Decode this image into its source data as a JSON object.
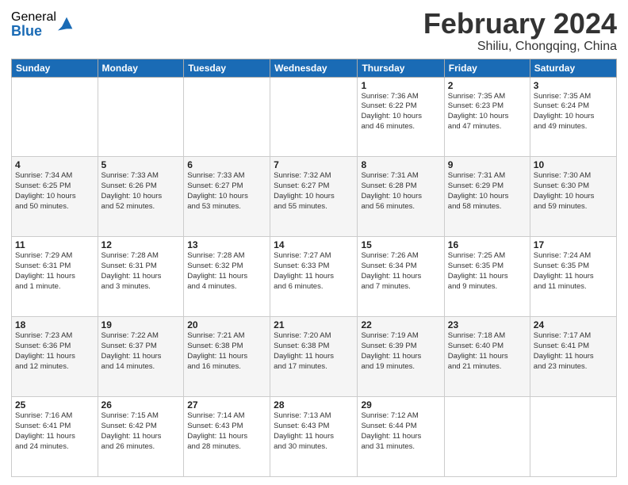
{
  "header": {
    "logo_general": "General",
    "logo_blue": "Blue",
    "month_title": "February 2024",
    "location": "Shiliu, Chongqing, China"
  },
  "days_of_week": [
    "Sunday",
    "Monday",
    "Tuesday",
    "Wednesday",
    "Thursday",
    "Friday",
    "Saturday"
  ],
  "weeks": [
    [
      {
        "day": "",
        "info": ""
      },
      {
        "day": "",
        "info": ""
      },
      {
        "day": "",
        "info": ""
      },
      {
        "day": "",
        "info": ""
      },
      {
        "day": "1",
        "info": "Sunrise: 7:36 AM\nSunset: 6:22 PM\nDaylight: 10 hours\nand 46 minutes."
      },
      {
        "day": "2",
        "info": "Sunrise: 7:35 AM\nSunset: 6:23 PM\nDaylight: 10 hours\nand 47 minutes."
      },
      {
        "day": "3",
        "info": "Sunrise: 7:35 AM\nSunset: 6:24 PM\nDaylight: 10 hours\nand 49 minutes."
      }
    ],
    [
      {
        "day": "4",
        "info": "Sunrise: 7:34 AM\nSunset: 6:25 PM\nDaylight: 10 hours\nand 50 minutes."
      },
      {
        "day": "5",
        "info": "Sunrise: 7:33 AM\nSunset: 6:26 PM\nDaylight: 10 hours\nand 52 minutes."
      },
      {
        "day": "6",
        "info": "Sunrise: 7:33 AM\nSunset: 6:27 PM\nDaylight: 10 hours\nand 53 minutes."
      },
      {
        "day": "7",
        "info": "Sunrise: 7:32 AM\nSunset: 6:27 PM\nDaylight: 10 hours\nand 55 minutes."
      },
      {
        "day": "8",
        "info": "Sunrise: 7:31 AM\nSunset: 6:28 PM\nDaylight: 10 hours\nand 56 minutes."
      },
      {
        "day": "9",
        "info": "Sunrise: 7:31 AM\nSunset: 6:29 PM\nDaylight: 10 hours\nand 58 minutes."
      },
      {
        "day": "10",
        "info": "Sunrise: 7:30 AM\nSunset: 6:30 PM\nDaylight: 10 hours\nand 59 minutes."
      }
    ],
    [
      {
        "day": "11",
        "info": "Sunrise: 7:29 AM\nSunset: 6:31 PM\nDaylight: 11 hours\nand 1 minute."
      },
      {
        "day": "12",
        "info": "Sunrise: 7:28 AM\nSunset: 6:31 PM\nDaylight: 11 hours\nand 3 minutes."
      },
      {
        "day": "13",
        "info": "Sunrise: 7:28 AM\nSunset: 6:32 PM\nDaylight: 11 hours\nand 4 minutes."
      },
      {
        "day": "14",
        "info": "Sunrise: 7:27 AM\nSunset: 6:33 PM\nDaylight: 11 hours\nand 6 minutes."
      },
      {
        "day": "15",
        "info": "Sunrise: 7:26 AM\nSunset: 6:34 PM\nDaylight: 11 hours\nand 7 minutes."
      },
      {
        "day": "16",
        "info": "Sunrise: 7:25 AM\nSunset: 6:35 PM\nDaylight: 11 hours\nand 9 minutes."
      },
      {
        "day": "17",
        "info": "Sunrise: 7:24 AM\nSunset: 6:35 PM\nDaylight: 11 hours\nand 11 minutes."
      }
    ],
    [
      {
        "day": "18",
        "info": "Sunrise: 7:23 AM\nSunset: 6:36 PM\nDaylight: 11 hours\nand 12 minutes."
      },
      {
        "day": "19",
        "info": "Sunrise: 7:22 AM\nSunset: 6:37 PM\nDaylight: 11 hours\nand 14 minutes."
      },
      {
        "day": "20",
        "info": "Sunrise: 7:21 AM\nSunset: 6:38 PM\nDaylight: 11 hours\nand 16 minutes."
      },
      {
        "day": "21",
        "info": "Sunrise: 7:20 AM\nSunset: 6:38 PM\nDaylight: 11 hours\nand 17 minutes."
      },
      {
        "day": "22",
        "info": "Sunrise: 7:19 AM\nSunset: 6:39 PM\nDaylight: 11 hours\nand 19 minutes."
      },
      {
        "day": "23",
        "info": "Sunrise: 7:18 AM\nSunset: 6:40 PM\nDaylight: 11 hours\nand 21 minutes."
      },
      {
        "day": "24",
        "info": "Sunrise: 7:17 AM\nSunset: 6:41 PM\nDaylight: 11 hours\nand 23 minutes."
      }
    ],
    [
      {
        "day": "25",
        "info": "Sunrise: 7:16 AM\nSunset: 6:41 PM\nDaylight: 11 hours\nand 24 minutes."
      },
      {
        "day": "26",
        "info": "Sunrise: 7:15 AM\nSunset: 6:42 PM\nDaylight: 11 hours\nand 26 minutes."
      },
      {
        "day": "27",
        "info": "Sunrise: 7:14 AM\nSunset: 6:43 PM\nDaylight: 11 hours\nand 28 minutes."
      },
      {
        "day": "28",
        "info": "Sunrise: 7:13 AM\nSunset: 6:43 PM\nDaylight: 11 hours\nand 30 minutes."
      },
      {
        "day": "29",
        "info": "Sunrise: 7:12 AM\nSunset: 6:44 PM\nDaylight: 11 hours\nand 31 minutes."
      },
      {
        "day": "",
        "info": ""
      },
      {
        "day": "",
        "info": ""
      }
    ]
  ]
}
